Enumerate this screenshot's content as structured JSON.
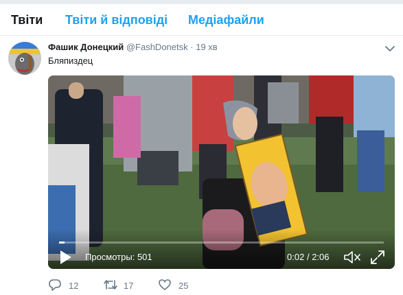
{
  "tabs": {
    "tweets": "Твіти",
    "tweets_replies": "Твіти й відповіді",
    "media": "Медіафайли"
  },
  "tweet": {
    "author_name": "Фашик Донецкий",
    "handle": "@FashDonetsk",
    "separator": "·",
    "time": "19 хв",
    "text": "Бляпиздец"
  },
  "video": {
    "views_label": "Просмотры:",
    "views_count": "501",
    "current_time": "0:02",
    "time_separator": "/",
    "duration": "2:06",
    "progress": 0.016
  },
  "actions": {
    "replies": "12",
    "retweets": "17",
    "likes": "25"
  },
  "colors": {
    "accent": "#1da1f2",
    "text": "#14171a",
    "muted": "#657786",
    "divider": "#e6ecf0"
  },
  "icons": [
    "caret-down-icon",
    "play-icon",
    "volume-mute-icon",
    "fullscreen-icon",
    "reply-icon",
    "retweet-icon",
    "like-icon"
  ]
}
